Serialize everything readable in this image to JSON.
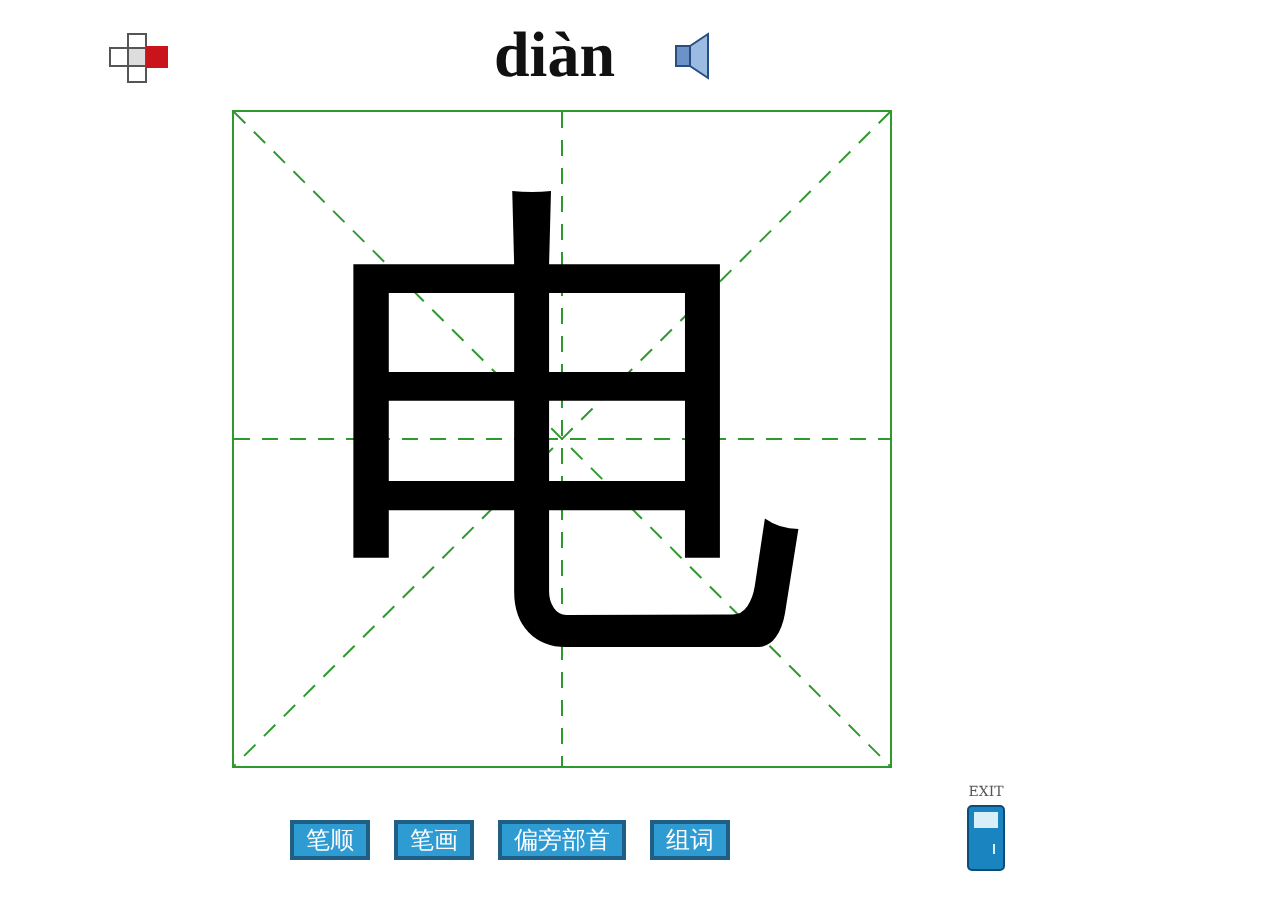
{
  "pinyin": "diàn",
  "character": "电",
  "buttons": [
    {
      "label": "笔顺"
    },
    {
      "label": "笔画"
    },
    {
      "label": "偏旁部首"
    },
    {
      "label": "组词"
    }
  ],
  "exit": {
    "label": "EXIT"
  }
}
